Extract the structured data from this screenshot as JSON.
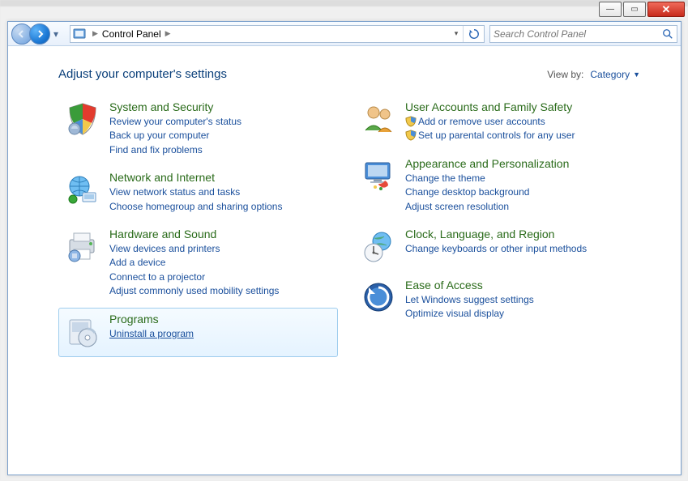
{
  "win_buttons": {
    "min": "—",
    "max": "▭",
    "close": "✕"
  },
  "breadcrumb": {
    "item": "Control Panel"
  },
  "search": {
    "placeholder": "Search Control Panel"
  },
  "header": {
    "title": "Adjust your computer's settings",
    "viewby_label": "View by:",
    "viewby_value": "Category"
  },
  "left": [
    {
      "title": "System and Security",
      "links": [
        {
          "text": "Review your computer's status"
        },
        {
          "text": "Back up your computer"
        },
        {
          "text": "Find and fix problems"
        }
      ]
    },
    {
      "title": "Network and Internet",
      "links": [
        {
          "text": "View network status and tasks"
        },
        {
          "text": "Choose homegroup and sharing options"
        }
      ]
    },
    {
      "title": "Hardware and Sound",
      "links": [
        {
          "text": "View devices and printers"
        },
        {
          "text": "Add a device"
        },
        {
          "text": "Connect to a projector"
        },
        {
          "text": "Adjust commonly used mobility settings"
        }
      ]
    },
    {
      "title": "Programs",
      "selected": true,
      "links": [
        {
          "text": "Uninstall a program"
        }
      ]
    }
  ],
  "right": [
    {
      "title": "User Accounts and Family Safety",
      "links": [
        {
          "text": "Add or remove user accounts",
          "shield": true
        },
        {
          "text": "Set up parental controls for any user",
          "shield": true
        }
      ]
    },
    {
      "title": "Appearance and Personalization",
      "links": [
        {
          "text": "Change the theme"
        },
        {
          "text": "Change desktop background"
        },
        {
          "text": "Adjust screen resolution"
        }
      ]
    },
    {
      "title": "Clock, Language, and Region",
      "links": [
        {
          "text": "Change keyboards or other input methods"
        }
      ]
    },
    {
      "title": "Ease of Access",
      "links": [
        {
          "text": "Let Windows suggest settings"
        },
        {
          "text": "Optimize visual display"
        }
      ]
    }
  ],
  "icons": {
    "system": "shield-colors",
    "network": "globe-network",
    "hardware": "printer",
    "programs": "disc-box",
    "users": "people",
    "appearance": "monitor-paint",
    "clock": "clock-globe",
    "ease": "blue-circle-arrow"
  }
}
